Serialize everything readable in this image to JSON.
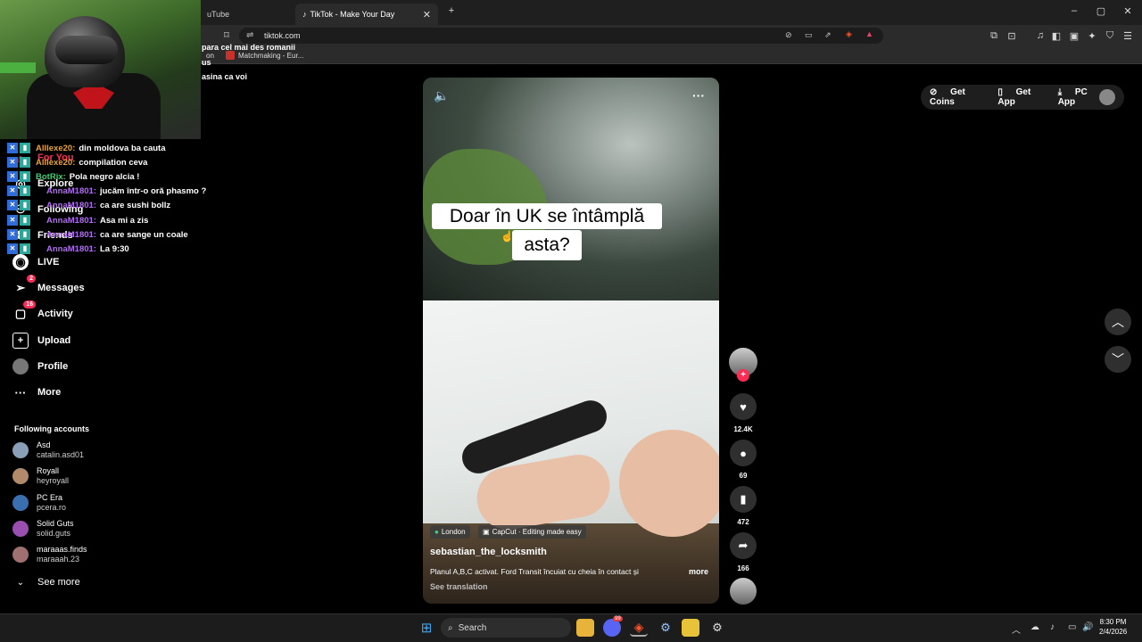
{
  "browser": {
    "tabs": [
      {
        "label": "uTube",
        "active": false
      },
      {
        "label": "TikTok - Make Your Day",
        "active": true
      }
    ],
    "new_tab": "+",
    "url": "tiktok.com",
    "window_controls": [
      "–",
      "▢",
      "✕"
    ],
    "bookmarks": [
      {
        "label": "on"
      },
      {
        "label": "Matchmaking - Eur..."
      }
    ]
  },
  "stream_overlay": {
    "top_chat": [
      "para cel mai des romanii",
      "us",
      "asina ca voi"
    ],
    "chat": [
      {
        "user": "Alllexe20:",
        "msg": "din moldova ba cauta",
        "color": "#e8a23a"
      },
      {
        "user": "Alllexe20:",
        "msg": "compilation ceva",
        "color": "#e8a23a"
      },
      {
        "user": "BotRix:",
        "msg": "Pola negro alcia !",
        "color": "#3bd16f"
      },
      {
        "user": "AnnaM1801:",
        "msg": "jucăm într-o oră phasmo ?",
        "color": "#b06cf0"
      },
      {
        "user": "AnnaM1801:",
        "msg": "ca are sushi bollz",
        "color": "#b06cf0"
      },
      {
        "user": "AnnaM1801:",
        "msg": "Asa mi a zis",
        "color": "#b06cf0"
      },
      {
        "user": "AnnaM1801:",
        "msg": "ca are sange un coale",
        "color": "#b06cf0"
      },
      {
        "user": "AnnaM1801:",
        "msg": "La 9:30",
        "color": "#b06cf0"
      }
    ]
  },
  "sidebar": {
    "items": [
      {
        "label": "For You",
        "icon": "home-icon"
      },
      {
        "label": "Explore",
        "icon": "compass-icon"
      },
      {
        "label": "Following",
        "icon": "following-icon"
      },
      {
        "label": "Friends",
        "icon": "friends-icon"
      },
      {
        "label": "LIVE",
        "icon": "live-icon"
      },
      {
        "label": "Messages",
        "icon": "messages-icon",
        "badge": "2"
      },
      {
        "label": "Activity",
        "icon": "activity-icon",
        "badge": "16"
      },
      {
        "label": "Upload",
        "icon": "upload-icon"
      },
      {
        "label": "Profile",
        "icon": "profile-icon"
      },
      {
        "label": "More",
        "icon": "more-icon"
      }
    ],
    "following_title": "Following accounts",
    "accounts": [
      {
        "name": "Asd",
        "handle": "catalin.asd01"
      },
      {
        "name": "Royall",
        "handle": "heyroyall"
      },
      {
        "name": "PC Era",
        "handle": "pcera.ro"
      },
      {
        "name": "Solid Guts",
        "handle": "solid.guts"
      },
      {
        "name": "maraaas.finds",
        "handle": "maraaah.23"
      }
    ],
    "see_more": "See more"
  },
  "video": {
    "caption_line1": "Doar în UK se întâmplă",
    "caption_line2": "asta?",
    "location": "London",
    "capcut": "CapCut · Editing made easy",
    "username": "sebastian_the_locksmith",
    "description": "Planul A,B,C activat. Ford Transit încuiat cu cheia în contact și",
    "more": "more",
    "translation": "See translation"
  },
  "actions": {
    "likes": "12.4K",
    "comments": "69",
    "saves": "472",
    "shares": "166"
  },
  "topright": {
    "coins": "Get Coins",
    "app": "Get App",
    "pc": "PC App"
  },
  "taskbar": {
    "search": "Search",
    "time": "8:30 PM",
    "date": "2/4/2026",
    "discord_badge": "99"
  },
  "colors": {
    "tiktok_red": "#fe2c55",
    "bg": "#000000"
  }
}
